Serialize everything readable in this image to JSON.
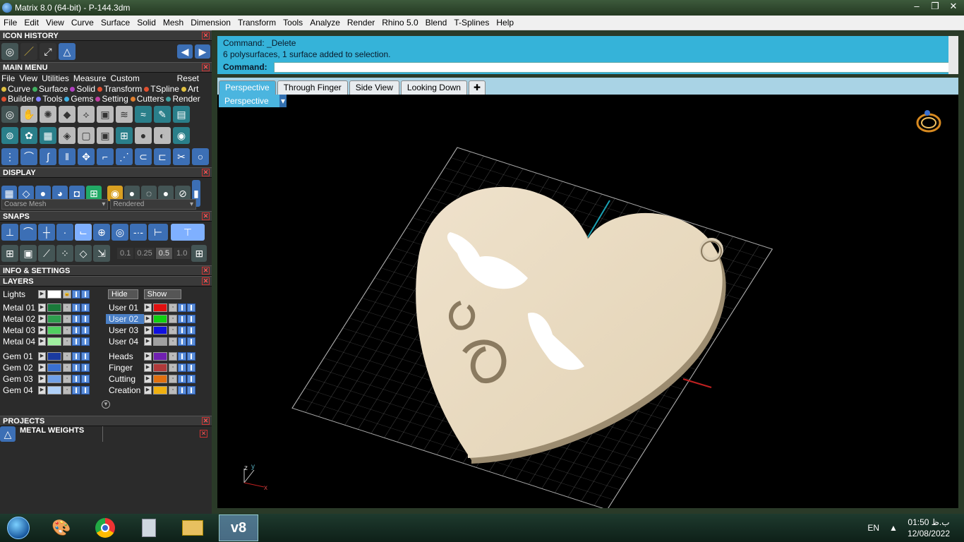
{
  "window": {
    "title": "Matrix 8.0 (64-bit) - P-144.3dm",
    "min": "–",
    "max": "❐",
    "close": "✕"
  },
  "menu": [
    "File",
    "Edit",
    "View",
    "Curve",
    "Surface",
    "Solid",
    "Mesh",
    "Dimension",
    "Transform",
    "Tools",
    "Analyze",
    "Render",
    "Rhino 5.0",
    "Blend",
    "T-Splines",
    "Help"
  ],
  "panels": {
    "icon_history": "ICON HISTORY",
    "main_menu": "MAIN MENU",
    "display": "DISPLAY",
    "snaps": "SNAPS",
    "info_settings": "INFO & SETTINGS",
    "layers": "LAYERS",
    "projects": "PROJECTS",
    "metal_weights": "METAL WEIGHTS"
  },
  "main_menu_items": [
    "File",
    "View",
    "Utilities",
    "Measure",
    "Custom",
    "Reset"
  ],
  "categories": [
    {
      "label": "Curve",
      "color": "#e0c040"
    },
    {
      "label": "Surface",
      "color": "#40b060"
    },
    {
      "label": "Solid",
      "color": "#b040c0"
    },
    {
      "label": "Transform",
      "color": "#e05030"
    },
    {
      "label": "TSpline",
      "color": "#e05030"
    },
    {
      "label": "Art",
      "color": "#e0c040"
    },
    {
      "label": "Builder",
      "color": "#e05030"
    },
    {
      "label": "Tools",
      "color": "#8080ff"
    },
    {
      "label": "Gems",
      "color": "#40b0e0"
    },
    {
      "label": "Setting",
      "color": "#c040a0"
    },
    {
      "label": "Cutters",
      "color": "#e08030"
    },
    {
      "label": "Render",
      "color": "#40a0a0"
    }
  ],
  "display": {
    "mesh": "Coarse Mesh",
    "mode": "Rendered"
  },
  "snap_values": [
    "0.1",
    "0.25",
    "0.5",
    "1.0"
  ],
  "layers_top": {
    "lights": "Lights",
    "hide": "Hide",
    "show": "Show"
  },
  "layers_left": [
    {
      "name": "Metal 01",
      "color": "#1a7a3a"
    },
    {
      "name": "Metal 02",
      "color": "#2e9e4e"
    },
    {
      "name": "Metal 03",
      "color": "#50d060"
    },
    {
      "name": "Metal 04",
      "color": "#a0f0a0"
    },
    {
      "name": "Gem 01",
      "color": "#1a3aa0"
    },
    {
      "name": "Gem 02",
      "color": "#3a70d0"
    },
    {
      "name": "Gem 03",
      "color": "#70a0e8"
    },
    {
      "name": "Gem 04",
      "color": "#b0d0f8"
    }
  ],
  "layers_right": [
    {
      "name": "User 01",
      "color": "#e01010"
    },
    {
      "name": "User 02",
      "color": "#10d010"
    },
    {
      "name": "User 03",
      "color": "#1010e0"
    },
    {
      "name": "User 04",
      "color": "#a0a0a0"
    },
    {
      "name": "Heads",
      "color": "#7020b0"
    },
    {
      "name": "Finger",
      "color": "#b03a3a"
    },
    {
      "name": "Cutting",
      "color": "#e07010"
    },
    {
      "name": "Creation",
      "color": "#f0b010"
    }
  ],
  "command": {
    "line1": "Command: _Delete",
    "line2": "6 polysurfaces, 1 surface added to selection.",
    "prompt": "Command:"
  },
  "view_tabs": [
    "Perspective",
    "Through Finger",
    "Side View",
    "Looking Down"
  ],
  "viewport_label": "Perspective",
  "axis_letters": {
    "z": "z",
    "y": "y",
    "x": "x"
  },
  "taskbar": {
    "lang": "EN",
    "time": "01:50 ب.ظ",
    "date": "12/08/2022",
    "active_app": "v8"
  }
}
